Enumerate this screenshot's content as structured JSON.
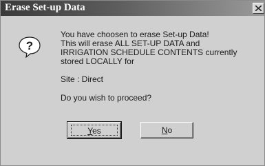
{
  "window": {
    "title": "Erase Set-up Data"
  },
  "message": {
    "line1": "You have choosen to erase Set-up Data!",
    "line2": "This will erase ALL SET-UP DATA and",
    "line3": "IRRIGATION SCHEDULE CONTENTS currently",
    "line4": "stored LOCALLY for",
    "site": "Site : Direct",
    "prompt": "Do you wish to proceed?"
  },
  "buttons": {
    "yes": {
      "mnemonic": "Y",
      "rest": "es"
    },
    "no": {
      "mnemonic": "N",
      "rest": "o"
    }
  },
  "icons": {
    "dialog": "question-icon",
    "close": "close-icon"
  },
  "colors": {
    "titlebar_start": "#3a3a3a",
    "titlebar_end": "#9a9a9a",
    "dialog_face": "#d0d0d0"
  }
}
